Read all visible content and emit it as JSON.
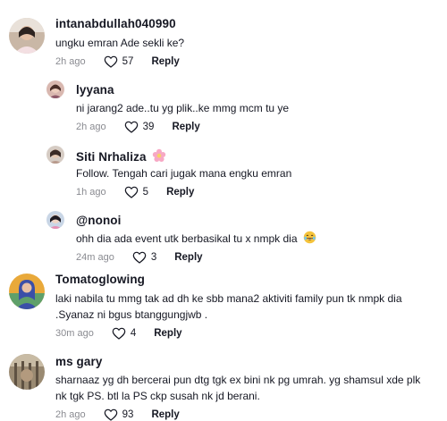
{
  "comments": [
    {
      "username": "intanabdullah040990",
      "text": "ungku emran Ade sekli ke?",
      "time": "2h ago",
      "likes": "57",
      "reply_label": "Reply"
    },
    {
      "username": "lyyana",
      "text": "ni jarang2 ade..tu yg plik..ke mmg mcm tu ye",
      "time": "2h ago",
      "likes": "39",
      "reply_label": "Reply"
    },
    {
      "username": "Siti Nrhaliza",
      "text": "Follow. Tengah cari jugak mana engku emran",
      "time": "1h ago",
      "likes": "5",
      "reply_label": "Reply"
    },
    {
      "username": "@nonoi",
      "text": "ohh dia ada event utk berbasikal tu x nmpk dia",
      "time": "24m ago",
      "likes": "3",
      "reply_label": "Reply"
    },
    {
      "username": "Tomatoglowing",
      "text": "laki nabila tu mmg tak ad dh ke sbb mana2 aktiviti family pun tk nmpk dia .Syanaz ni bgus btanggungjwb .",
      "time": "30m ago",
      "likes": "4",
      "reply_label": "Reply"
    },
    {
      "username": "ms gary",
      "text": "sharnaaz yg dh bercerai pun dtg tgk ex bini nk pg umrah. yg shamsul xde plk nk tgk PS. btl la PS ckp susah nk jd berani.",
      "time": "2h ago",
      "likes": "93",
      "reply_label": "Reply"
    }
  ],
  "icons": {
    "like": "heart-outline-icon",
    "flower_emoji": "flower-emoji-icon",
    "laugh_emoji": "laughing-emoji-icon"
  },
  "colors": {
    "text": "#161823",
    "meta": "#8a8b91",
    "flower": "#f7a8c4",
    "laugh": "#f5c33b"
  }
}
